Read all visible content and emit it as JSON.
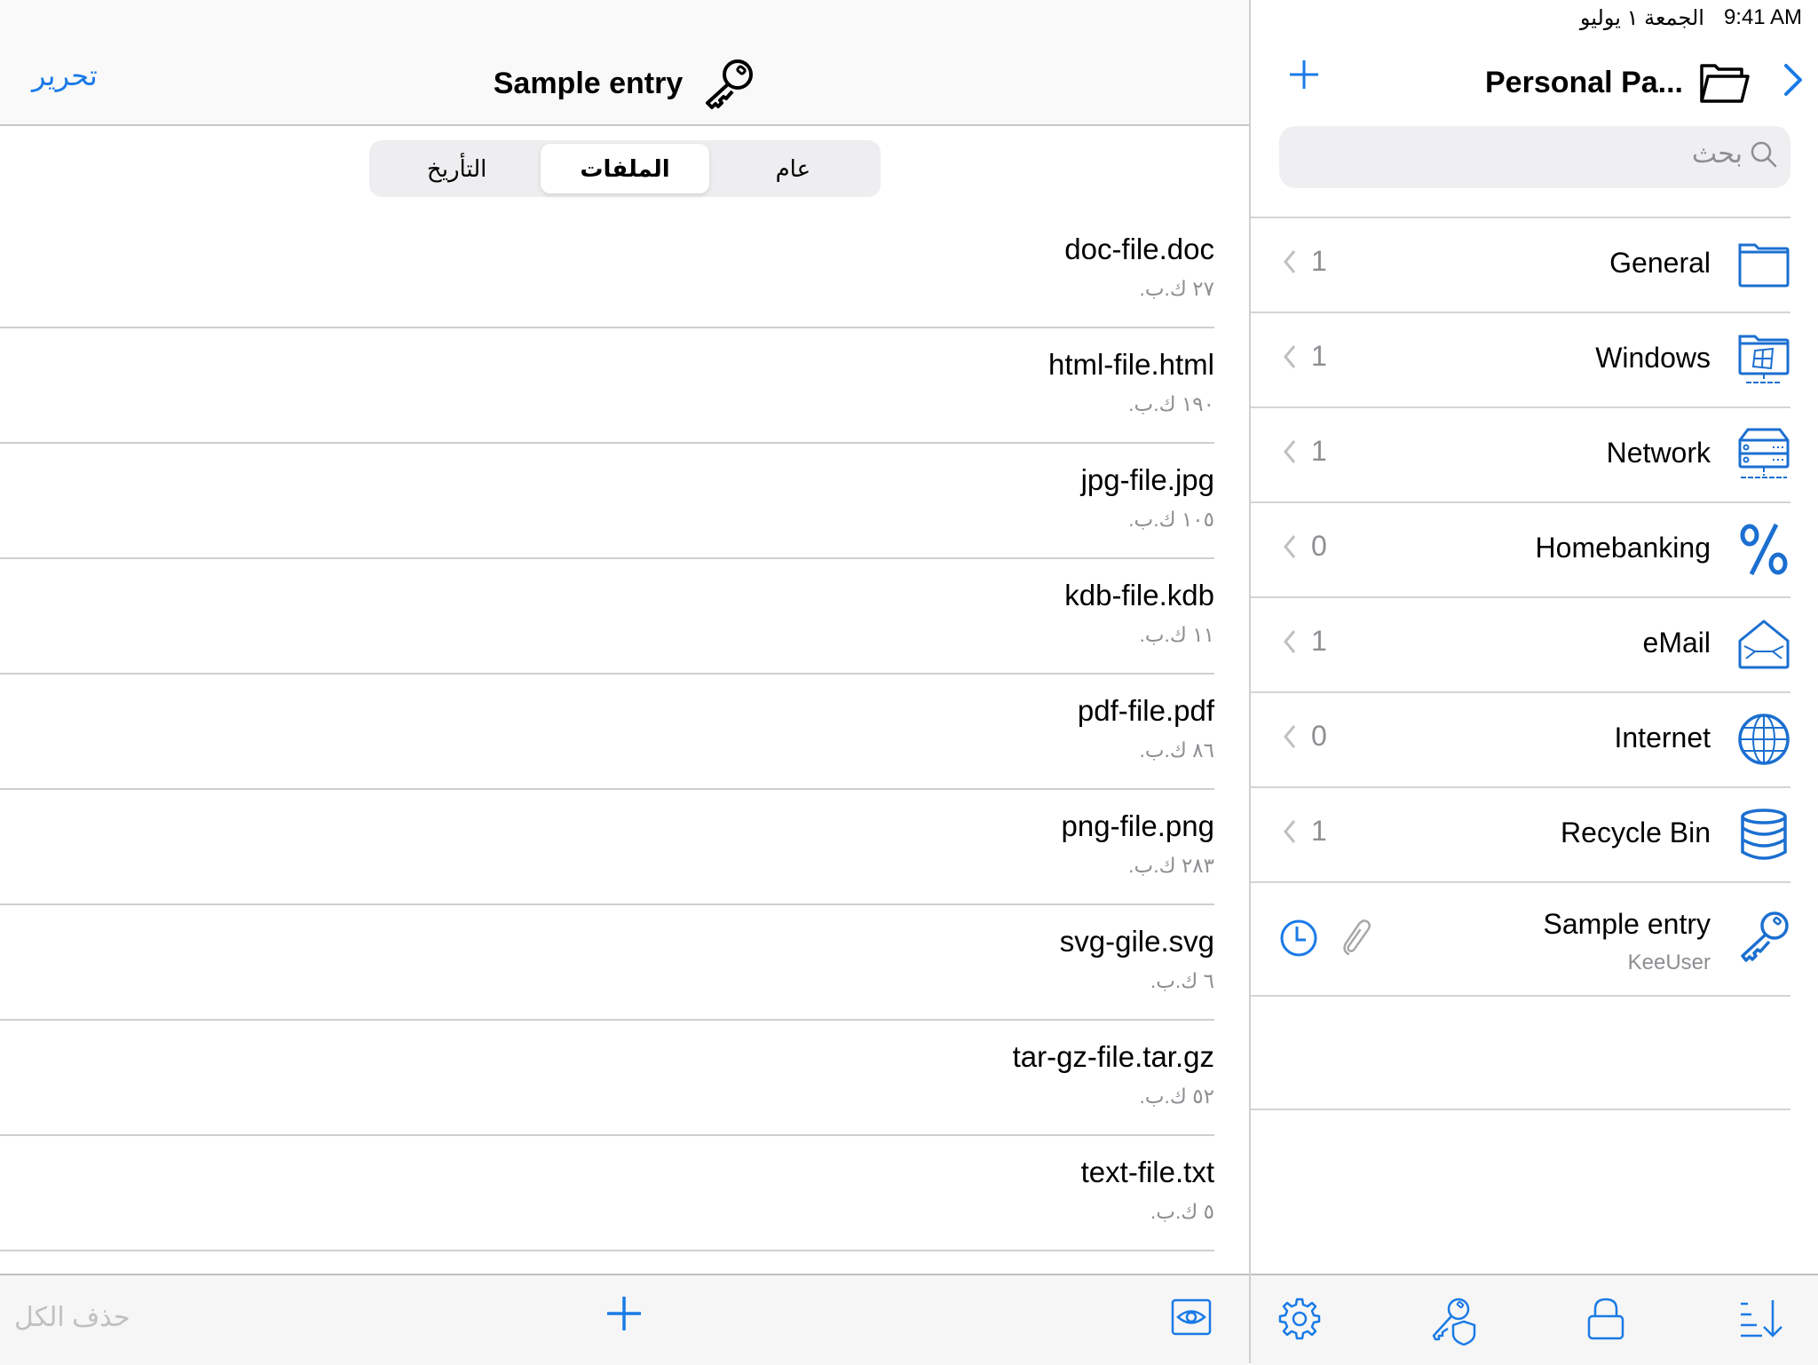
{
  "status_bar": {
    "time": "9:41 AM",
    "date": "الجمعة ١ يوليو"
  },
  "detail": {
    "edit_label": "تحرير",
    "title": "Sample entry",
    "title_icon": "key-icon",
    "segments": [
      {
        "label": "عام",
        "active": false
      },
      {
        "label": "الملفات",
        "active": true
      },
      {
        "label": "التأريخ",
        "active": false
      }
    ],
    "files": [
      {
        "name": "doc-file.doc",
        "size": "٢٧ ك.ب."
      },
      {
        "name": "html-file.html",
        "size": "١٩٠ ك.ب."
      },
      {
        "name": "jpg-file.jpg",
        "size": "١٠٥ ك.ب."
      },
      {
        "name": "kdb-file.kdb",
        "size": "١١ ك.ب."
      },
      {
        "name": "pdf-file.pdf",
        "size": "٨٦ ك.ب."
      },
      {
        "name": "png-file.png",
        "size": "٢٨٣ ك.ب."
      },
      {
        "name": "svg-gile.svg",
        "size": "٦ ك.ب."
      },
      {
        "name": "tar-gz-file.tar.gz",
        "size": "٥٢ ك.ب."
      },
      {
        "name": "text-file.txt",
        "size": "٥ ك.ب."
      }
    ],
    "toolbar": {
      "delete_all_label": "حذف الكل",
      "add_icon": "plus-icon",
      "preview_icon": "eye-icon"
    }
  },
  "master": {
    "title": "Personal Pa...",
    "title_icon": "folder-open-icon",
    "search_placeholder": "بحث",
    "groups": [
      {
        "label": "General",
        "count": "1",
        "icon": "folder-icon"
      },
      {
        "label": "Windows",
        "count": "1",
        "icon": "windows-folder-icon"
      },
      {
        "label": "Network",
        "count": "1",
        "icon": "server-icon"
      },
      {
        "label": "Homebanking",
        "count": "0",
        "icon": "percent-icon"
      },
      {
        "label": "eMail",
        "count": "1",
        "icon": "envelope-icon"
      },
      {
        "label": "Internet",
        "count": "0",
        "icon": "globe-icon"
      },
      {
        "label": "Recycle Bin",
        "count": "1",
        "icon": "database-icon"
      }
    ],
    "entry": {
      "title": "Sample entry",
      "username": "KeeUser",
      "icon": "key-icon"
    },
    "toolbar": [
      "gear-icon",
      "key-shield-icon",
      "lock-icon",
      "sort-icon"
    ]
  },
  "colors": {
    "accent": "#1a7ae6",
    "icon_blue": "#1b6fd0",
    "secondary_text": "#8e8e93",
    "separator": "#d4d4d4"
  }
}
